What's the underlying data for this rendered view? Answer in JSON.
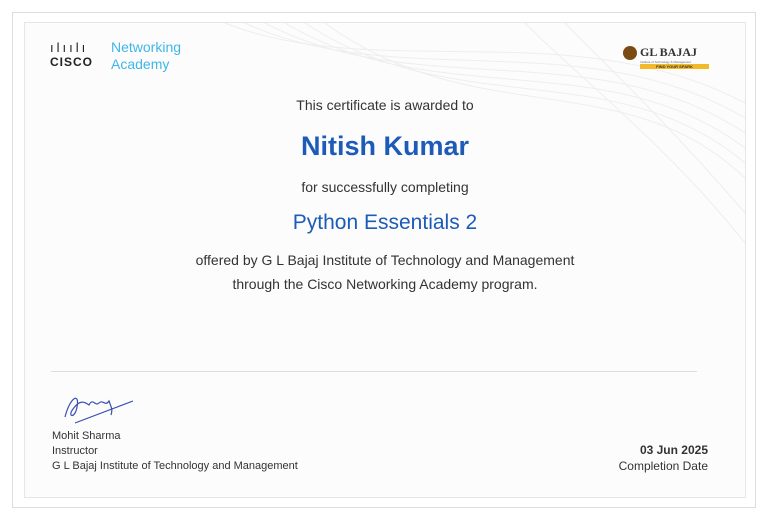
{
  "logo_left": {
    "brand": "CISCO",
    "line1": "Networking",
    "line2": "Academy"
  },
  "logo_right": {
    "name": "GL BAJAJ",
    "subtitle": "Institute of Technology & Management",
    "tagline": "FIND YOUR SPARK"
  },
  "awarded_text": "This certificate is awarded to",
  "recipient": "Nitish Kumar",
  "completing_text": "for successfully completing",
  "course": "Python Essentials 2",
  "offered_line1": "offered by G L Bajaj Institute of Technology and Management",
  "offered_line2": "through the Cisco Networking Academy program.",
  "instructor": {
    "name": "Mohit Sharma",
    "role": "Instructor",
    "institution": "G L Bajaj Institute of Technology and Management"
  },
  "completion": {
    "date": "03 Jun 2025",
    "label": "Completion Date"
  },
  "colors": {
    "blue": "#1d5bb8",
    "cisco_light": "#3fb6e8"
  }
}
